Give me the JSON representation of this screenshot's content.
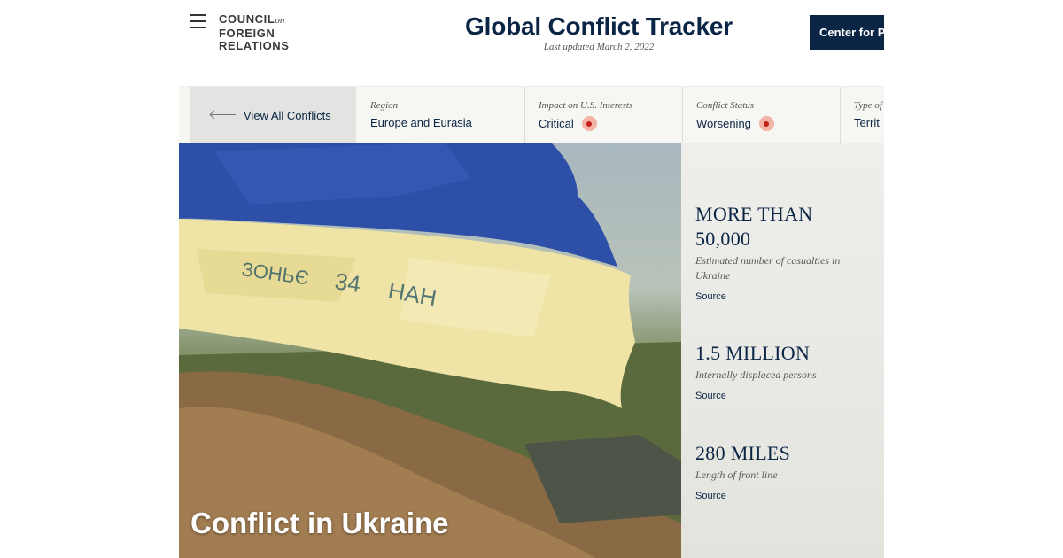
{
  "header": {
    "logo_lines": [
      "COUNCIL",
      "FOREIGN",
      "RELATIONS"
    ],
    "logo_on": "on",
    "title": "Global Conflict Tracker",
    "updated": "Last updated March 2, 2022",
    "center_button": "Center for P"
  },
  "infobar": {
    "back_label": "View All Conflicts",
    "items": [
      {
        "label": "Region",
        "value": "Europe and Eurasia"
      },
      {
        "label": "Impact on U.S. Interests",
        "value": "Critical"
      },
      {
        "label": "Conflict Status",
        "value": "Worsening"
      },
      {
        "label": "Type of",
        "value": "Territ"
      }
    ]
  },
  "hero": {
    "title": "Conflict in Ukraine"
  },
  "stats": [
    {
      "number": "MORE THAN 50,000",
      "number_lines": [
        "MORE THAN",
        "50,000"
      ],
      "description": "Estimated number of casualties in Ukraine",
      "source": "Source"
    },
    {
      "number": "1.5 MILLION",
      "description": "Internally displaced persons",
      "source": "Source"
    },
    {
      "number": "280 MILES",
      "description": "Length of front line",
      "source": "Source"
    }
  ],
  "colors": {
    "navy": "#0b2545",
    "status_dot": "#c0221a",
    "flag_blue": "#2e4fa8",
    "flag_yellow": "#efe3a6"
  },
  "icons": [
    "hamburger-menu-icon",
    "arrow-left-icon",
    "status-dot-icon"
  ]
}
